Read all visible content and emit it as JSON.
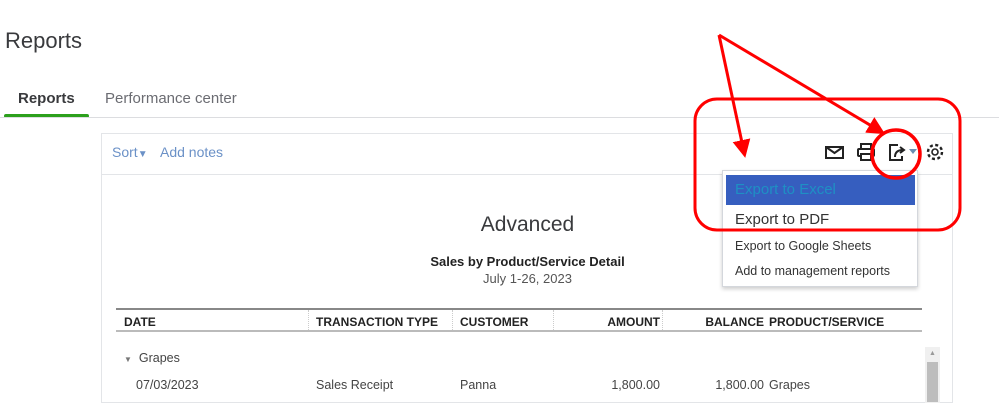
{
  "page": {
    "title": "Reports"
  },
  "tabs": [
    {
      "label": "Reports",
      "active": true
    },
    {
      "label": "Performance center",
      "active": false
    }
  ],
  "toolbar": {
    "sort_label": "Sort",
    "add_notes_label": "Add notes",
    "icons": [
      "email-icon",
      "print-icon",
      "export-icon",
      "settings-icon"
    ]
  },
  "report": {
    "company": "Advanced",
    "name": "Sales by Product/Service Detail",
    "date_range": "July 1-26, 2023",
    "columns": [
      "DATE",
      "TRANSACTION TYPE",
      "CUSTOMER",
      "AMOUNT",
      "BALANCE",
      "PRODUCT/SERVICE"
    ],
    "group": "Grapes",
    "rows": [
      {
        "date": "07/03/2023",
        "type": "Sales Receipt",
        "customer": "Panna",
        "amount": "1,800.00",
        "balance": "1,800.00",
        "product": "Grapes"
      }
    ]
  },
  "export_menu": {
    "items": [
      "Export to Excel",
      "Export to PDF",
      "Export to Google Sheets",
      "Add to management reports"
    ],
    "highlighted": "Export to Excel"
  },
  "colors": {
    "accent_green": "#2ca01c",
    "link_blue": "#6b91c7",
    "highlight": "#365ebf",
    "annotation_red": "#ff0000"
  }
}
